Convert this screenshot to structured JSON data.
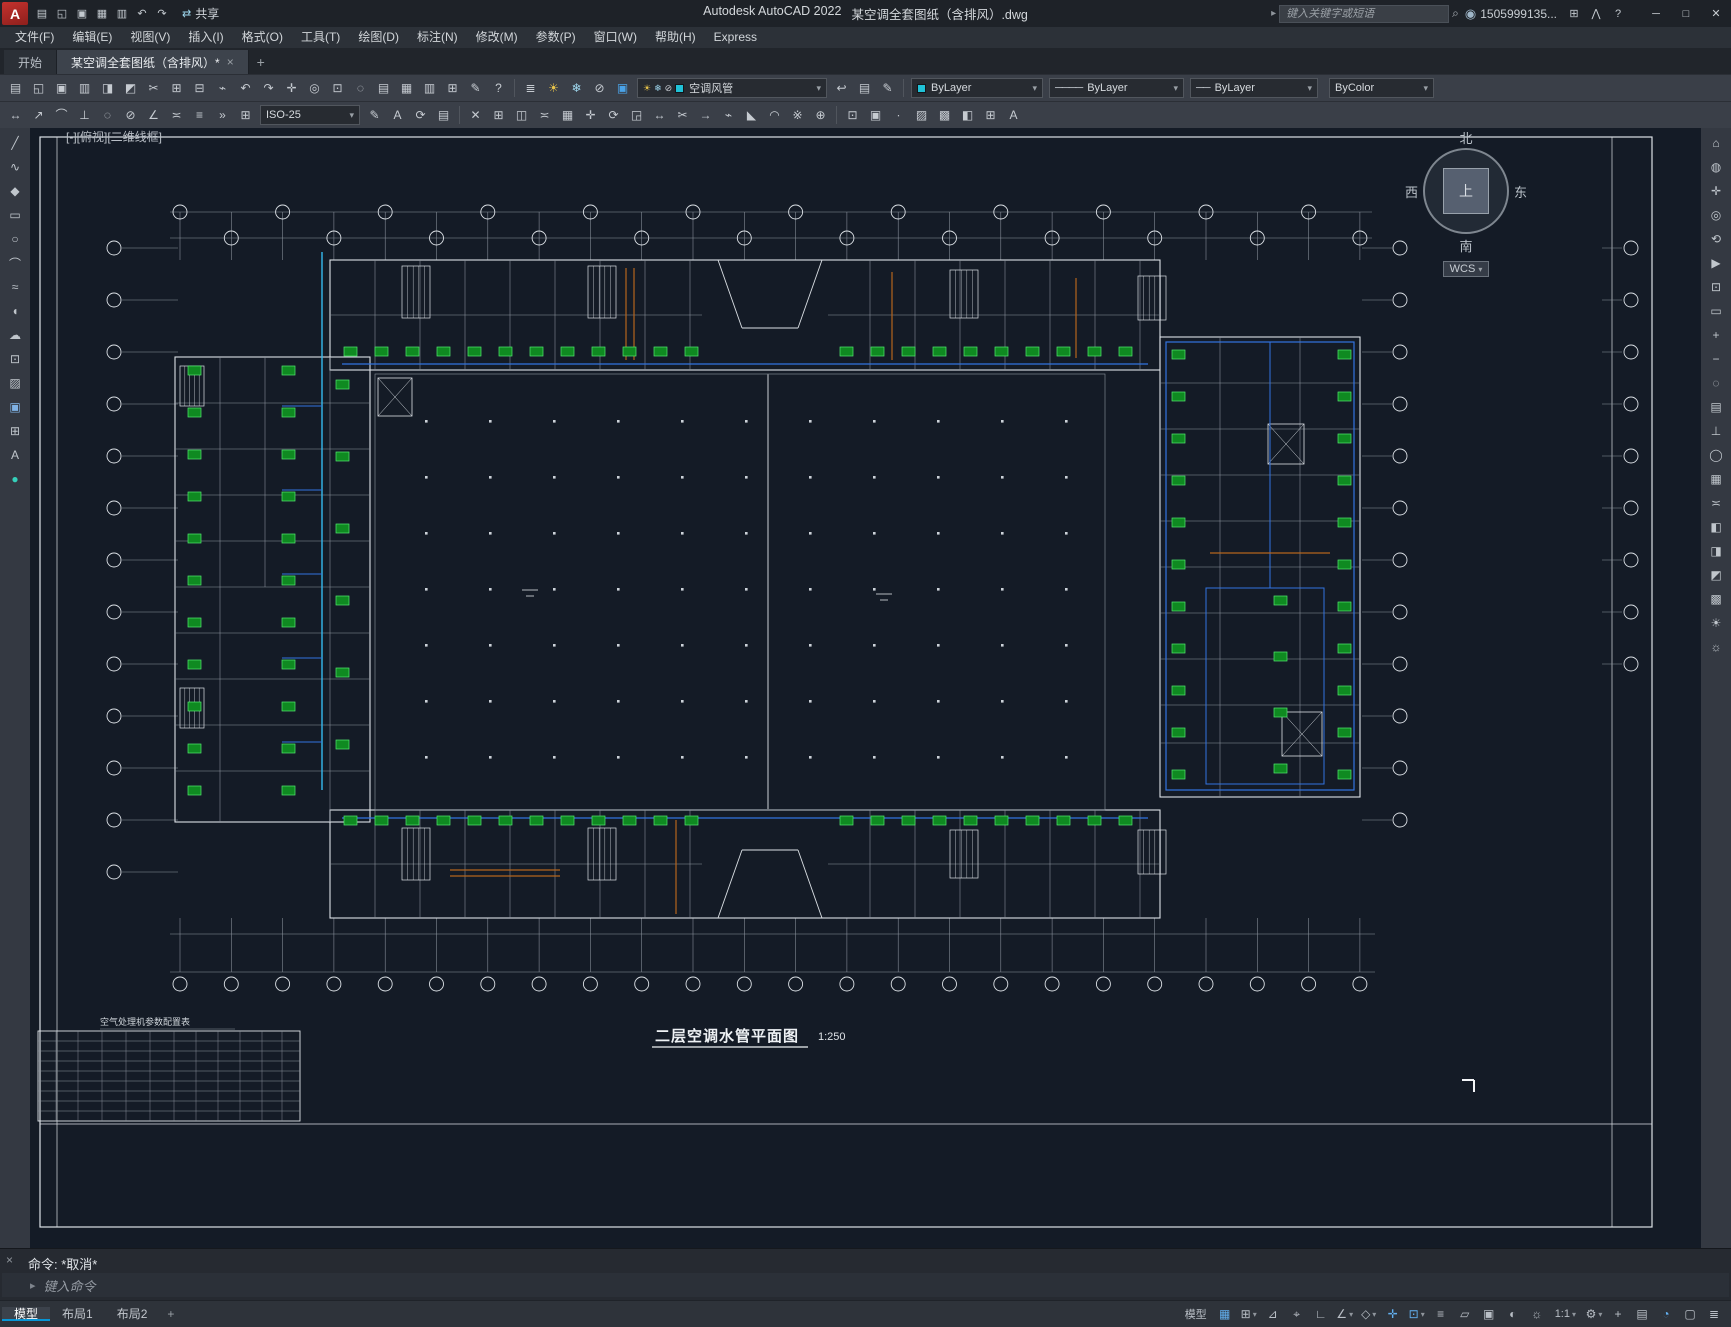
{
  "colors": {
    "accent_blue": "#0696d7",
    "canvas_bg": "#141b26",
    "line_white": "#dce1e6",
    "unit_green": "#2bd445",
    "pipe_blue": "#3273e0",
    "cyan_pipe": "#35b9ef",
    "duct_orange": "#b5651d"
  },
  "glyphs": {
    "caret_down": "▾",
    "close": "×",
    "add": "+",
    "minimize": "─",
    "maximize": "□"
  },
  "titlebar": {
    "logo": {
      "name": "autocad-logo",
      "glyph": "A"
    },
    "quick_access": [
      {
        "name": "qnew-icon",
        "glyph": "▤"
      },
      {
        "name": "open-icon",
        "glyph": "◱"
      },
      {
        "name": "save-icon",
        "glyph": "▣"
      },
      {
        "name": "save-as-icon",
        "glyph": "▦"
      },
      {
        "name": "plot-icon",
        "glyph": "▥"
      },
      {
        "name": "undo-icon",
        "glyph": "↶"
      },
      {
        "name": "redo-icon",
        "glyph": "↷"
      }
    ],
    "share_icon": {
      "name": "share-icon",
      "glyph": "⇄"
    },
    "share_label": "共享",
    "app_title": "Autodesk AutoCAD 2022",
    "doc_title": "某空调全套图纸（含排风）.dwg",
    "search_caret_icon": {
      "name": "search-expand-icon",
      "glyph": "▸"
    },
    "search_placeholder": "键入关键字或短语",
    "search_icon": {
      "name": "search-icon",
      "glyph": "⌕"
    },
    "account_icon": {
      "name": "user-avatar-icon",
      "glyph": "◉"
    },
    "account_id": "1505999135...",
    "extra_icons": [
      {
        "name": "app-store-icon",
        "glyph": "⊞"
      },
      {
        "name": "autodesk-apps-icon",
        "glyph": "⋀"
      },
      {
        "name": "help-menu-icon",
        "glyph": "?"
      }
    ]
  },
  "menubar": {
    "items": [
      {
        "name": "file",
        "label": "文件(F)"
      },
      {
        "name": "edit",
        "label": "编辑(E)"
      },
      {
        "name": "view",
        "label": "视图(V)"
      },
      {
        "name": "insert",
        "label": "插入(I)"
      },
      {
        "name": "format",
        "label": "格式(O)"
      },
      {
        "name": "tools",
        "label": "工具(T)"
      },
      {
        "name": "draw",
        "label": "绘图(D)"
      },
      {
        "name": "dimension",
        "label": "标注(N)"
      },
      {
        "name": "modify",
        "label": "修改(M)"
      },
      {
        "name": "parametric",
        "label": "参数(P)"
      },
      {
        "name": "window",
        "label": "窗口(W)"
      },
      {
        "name": "help",
        "label": "帮助(H)"
      },
      {
        "name": "express",
        "label": "Express"
      }
    ]
  },
  "filetabs": {
    "start_label": "开始",
    "doc_label": "某空调全套图纸（含排风）*"
  },
  "toolbar1": {
    "icons_left": [
      {
        "name": "new-icon",
        "glyph": "▤"
      },
      {
        "name": "open-icon",
        "glyph": "◱"
      },
      {
        "name": "save-icon",
        "glyph": "▣"
      },
      {
        "name": "plot-icon",
        "glyph": "▥"
      },
      {
        "name": "plot-preview-icon",
        "glyph": "◨"
      },
      {
        "name": "publish-icon",
        "glyph": "◩"
      },
      {
        "name": "cut-icon",
        "glyph": "✂"
      },
      {
        "name": "copy-clip-icon",
        "glyph": "⊞"
      },
      {
        "name": "paste-icon",
        "glyph": "⊟"
      },
      {
        "name": "match-properties-icon",
        "glyph": "⌁"
      },
      {
        "name": "undo-icon",
        "glyph": "↶"
      },
      {
        "name": "redo-icon",
        "glyph": "↷"
      },
      {
        "name": "pan-icon",
        "glyph": "✛"
      },
      {
        "name": "zoom-realtime-icon",
        "glyph": "◎"
      },
      {
        "name": "zoom-window-icon",
        "glyph": "⊡"
      },
      {
        "name": "zoom-previous-icon",
        "glyph": "◌"
      },
      {
        "name": "properties-icon",
        "glyph": "▤"
      },
      {
        "name": "design-center-icon",
        "glyph": "▦"
      },
      {
        "name": "tool-palettes-icon",
        "glyph": "▥"
      },
      {
        "name": "sheet-set-manager-icon",
        "glyph": "⊞"
      },
      {
        "name": "markup-icon",
        "glyph": "✎"
      },
      {
        "name": "help-icon",
        "glyph": "?"
      }
    ],
    "layer_tool_icons": [
      {
        "name": "layer-properties-icon",
        "glyph": "≣"
      },
      {
        "name": "layer-on-icon",
        "glyph": "☀",
        "color": "#e8c44a"
      },
      {
        "name": "layer-freeze-icon",
        "glyph": "❄",
        "color": "#9fd8ef"
      },
      {
        "name": "layer-lock-icon",
        "glyph": "⊘",
        "color": "#c9ced4"
      },
      {
        "name": "layer-color-icon",
        "glyph": "▣",
        "color": "#4aa3e8"
      }
    ],
    "layer_dropdown": {
      "value": "空调风管",
      "swatch": "#20c2d7",
      "state_icons": [
        {
          "name": "layer-on-icon",
          "glyph": "☀",
          "color": "#e8c44a"
        },
        {
          "name": "layer-freeze-icon",
          "glyph": "❄",
          "color": "#9fd8ef"
        },
        {
          "name": "layer-lock-icon",
          "glyph": "⊘",
          "color": "#c9ced4"
        }
      ]
    },
    "icons_mid": [
      {
        "name": "layer-previous-icon",
        "glyph": "↩"
      },
      {
        "name": "layer-states-icon",
        "glyph": "▤"
      },
      {
        "name": "make-current-layer-icon",
        "glyph": "✎"
      }
    ],
    "color_dropdown": {
      "value": "ByLayer",
      "swatch": "#20c2d7"
    },
    "linetype_dropdown": {
      "value": "ByLayer",
      "line_glyph": "────"
    },
    "lineweight_dropdown": {
      "value": "ByLayer",
      "line_glyph": "──"
    },
    "plotstyle_dropdown": {
      "value": "ByColor"
    }
  },
  "toolbar2": {
    "icons_a": [
      {
        "name": "dim-linear-icon",
        "glyph": "↔"
      },
      {
        "name": "dim-aligned-icon",
        "glyph": "↗"
      },
      {
        "name": "dim-arc-icon",
        "glyph": "⌒"
      },
      {
        "name": "dim-ordinate-icon",
        "glyph": "⊥"
      },
      {
        "name": "dim-radius-icon",
        "glyph": "◌"
      },
      {
        "name": "dim-diameter-icon",
        "glyph": "⊘"
      },
      {
        "name": "dim-angular-icon",
        "glyph": "∠"
      },
      {
        "name": "dim-quick-icon",
        "glyph": "≍"
      },
      {
        "name": "dim-baseline-icon",
        "glyph": "≡"
      },
      {
        "name": "dim-continue-icon",
        "glyph": "»"
      },
      {
        "name": "dim-tolerance-icon",
        "glyph": "⊞"
      }
    ],
    "dimstyle_dropdown": {
      "value": "ISO-25"
    },
    "icons_b": [
      {
        "name": "dim-edit-icon",
        "glyph": "✎"
      },
      {
        "name": "dim-text-edit-icon",
        "glyph": "A"
      },
      {
        "name": "dim-update-icon",
        "glyph": "⟳"
      },
      {
        "name": "dim-style-icon",
        "glyph": "▤"
      }
    ],
    "icons_c": [
      {
        "name": "erase-icon",
        "glyph": "✕"
      },
      {
        "name": "copy-icon",
        "glyph": "⊞"
      },
      {
        "name": "mirror-icon",
        "glyph": "◫"
      },
      {
        "name": "offset-icon",
        "glyph": "≍"
      },
      {
        "name": "array-icon",
        "glyph": "▦"
      },
      {
        "name": "move-icon",
        "glyph": "✛"
      },
      {
        "name": "rotate-icon",
        "glyph": "⟳"
      },
      {
        "name": "scale-icon",
        "glyph": "◲"
      },
      {
        "name": "stretch-icon",
        "glyph": "↔"
      },
      {
        "name": "trim-icon",
        "glyph": "✂"
      },
      {
        "name": "extend-icon",
        "glyph": "→"
      },
      {
        "name": "break-icon",
        "glyph": "⌁"
      },
      {
        "name": "chamfer-icon",
        "glyph": "◣"
      },
      {
        "name": "fillet-icon",
        "glyph": "◠"
      },
      {
        "name": "explode-icon",
        "glyph": "※"
      },
      {
        "name": "join-icon",
        "glyph": "⊕"
      }
    ],
    "icons_d": [
      {
        "name": "insert-block-icon",
        "glyph": "⊡"
      },
      {
        "name": "make-block-icon",
        "glyph": "▣"
      },
      {
        "name": "point-icon",
        "glyph": "∙"
      },
      {
        "name": "hatch-icon",
        "glyph": "▨"
      },
      {
        "name": "gradient-icon",
        "glyph": "▩"
      },
      {
        "name": "region-icon",
        "glyph": "◧"
      },
      {
        "name": "table-icon",
        "glyph": "⊞"
      },
      {
        "name": "mtext-icon",
        "glyph": "A"
      }
    ]
  },
  "palettes": {
    "left": [
      {
        "name": "line-tool-icon",
        "glyph": "╱"
      },
      {
        "name": "polyline-tool-icon",
        "glyph": "∿"
      },
      {
        "name": "polygon-tool-icon",
        "glyph": "◆"
      },
      {
        "name": "rectangle-tool-icon",
        "glyph": "▭"
      },
      {
        "name": "circle-tool-icon",
        "glyph": "○"
      },
      {
        "name": "arc-tool-icon",
        "glyph": "⌒"
      },
      {
        "name": "spline-tool-icon",
        "glyph": "≈"
      },
      {
        "name": "ellipse-tool-icon",
        "glyph": "◖"
      },
      {
        "name": "revision-cloud-icon",
        "glyph": "☁"
      },
      {
        "name": "insert-block-icon",
        "glyph": "⊡"
      },
      {
        "name": "hatch-tool-icon",
        "glyph": "▨"
      },
      {
        "name": "image-attach-icon",
        "glyph": "▣",
        "color": "#7fb2e5"
      },
      {
        "name": "table-tool-icon",
        "glyph": "⊞"
      },
      {
        "name": "text-tool-icon",
        "glyph": "A"
      },
      {
        "name": "point-style-icon",
        "glyph": "●",
        "color": "#35d0ba"
      }
    ],
    "right": [
      {
        "name": "nav-home-icon",
        "glyph": "⌂"
      },
      {
        "name": "steering-wheel-icon",
        "glyph": "◍"
      },
      {
        "name": "pan-icon",
        "glyph": "✛"
      },
      {
        "name": "zoom-icon",
        "glyph": "◎"
      },
      {
        "name": "orbit-icon",
        "glyph": "⟲"
      },
      {
        "name": "show-motion-icon",
        "glyph": "▶"
      },
      {
        "name": "zoom-extents-icon",
        "glyph": "⊡"
      },
      {
        "name": "zoom-window-icon",
        "glyph": "▭"
      },
      {
        "name": "zoom-in-icon",
        "glyph": "+"
      },
      {
        "name": "zoom-out-icon",
        "glyph": "−"
      },
      {
        "name": "zoom-previous-icon",
        "glyph": "◌"
      },
      {
        "name": "named-views-icon",
        "glyph": "▤"
      },
      {
        "name": "ucs-icon",
        "glyph": "⊥"
      },
      {
        "name": "world-ucs-icon",
        "glyph": "◯"
      },
      {
        "name": "layer-walk-icon",
        "glyph": "▦"
      },
      {
        "name": "measure-icon",
        "glyph": "≍"
      },
      {
        "name": "section-plane-icon",
        "glyph": "◧"
      },
      {
        "name": "camera-icon",
        "glyph": "◨"
      },
      {
        "name": "render-icon",
        "glyph": "◩"
      },
      {
        "name": "materials-icon",
        "glyph": "▩"
      },
      {
        "name": "lights-icon",
        "glyph": "☀"
      },
      {
        "name": "sun-properties-icon",
        "glyph": "☼"
      }
    ]
  },
  "canvas": {
    "viewport_controls": "[-][俯视][二维线框]",
    "viewcube": {
      "north": "北",
      "west": "西",
      "east": "东",
      "south": "南",
      "top": "上",
      "wcs": "WCS"
    },
    "plan_title": "二层空调水管平面图",
    "plan_scale": "1:250",
    "table_title": "空气处理机参数配置表"
  },
  "command": {
    "history": "命令: *取消*",
    "prompt_icon": {
      "name": "command-input-icon",
      "glyph": "▸"
    },
    "input_placeholder": "键入命令"
  },
  "statusbar": {
    "layout_tabs": [
      {
        "name": "model",
        "label": "模型",
        "active": true
      },
      {
        "name": "layout1",
        "label": "布局1"
      },
      {
        "name": "layout2",
        "label": "布局2"
      }
    ],
    "right_items": [
      {
        "name": "model-space-toggle",
        "label": "模型"
      },
      {
        "name": "grid-display-icon",
        "glyph": "▦",
        "active": true
      },
      {
        "name": "snap-mode-icon",
        "glyph": "⊞",
        "caret": true
      },
      {
        "name": "infer-constraints-icon",
        "glyph": "⊿"
      },
      {
        "name": "dynamic-input-icon",
        "glyph": "⌖"
      },
      {
        "name": "ortho-mode-icon",
        "glyph": "∟"
      },
      {
        "name": "polar-tracking-icon",
        "glyph": "∠",
        "caret": true
      },
      {
        "name": "isodraft-icon",
        "glyph": "◇",
        "caret": true
      },
      {
        "name": "object-snap-tracking-icon",
        "glyph": "✛",
        "active": true
      },
      {
        "name": "object-snap-icon",
        "glyph": "⊡",
        "active": true,
        "caret": true
      },
      {
        "name": "lineweight-display-icon",
        "glyph": "≡"
      },
      {
        "name": "transparency-icon",
        "glyph": "▱"
      },
      {
        "name": "selection-cycling-icon",
        "glyph": "▣"
      },
      {
        "name": "annotation-visibility-icon",
        "glyph": "◐"
      },
      {
        "name": "autoscale-icon",
        "glyph": "☼"
      },
      {
        "name": "annotation-scale-label",
        "label": "1:1",
        "caret": true
      },
      {
        "name": "workspace-switching-icon",
        "glyph": "⚙",
        "caret": true
      },
      {
        "name": "annotation-monitor-icon",
        "glyph": "+"
      },
      {
        "name": "quick-properties-icon",
        "glyph": "▤"
      },
      {
        "name": "graphics-performance-icon",
        "glyph": "◔",
        "active": true
      },
      {
        "name": "clean-screen-icon",
        "glyph": "▢"
      },
      {
        "name": "customization-icon",
        "glyph": "≣"
      }
    ]
  }
}
